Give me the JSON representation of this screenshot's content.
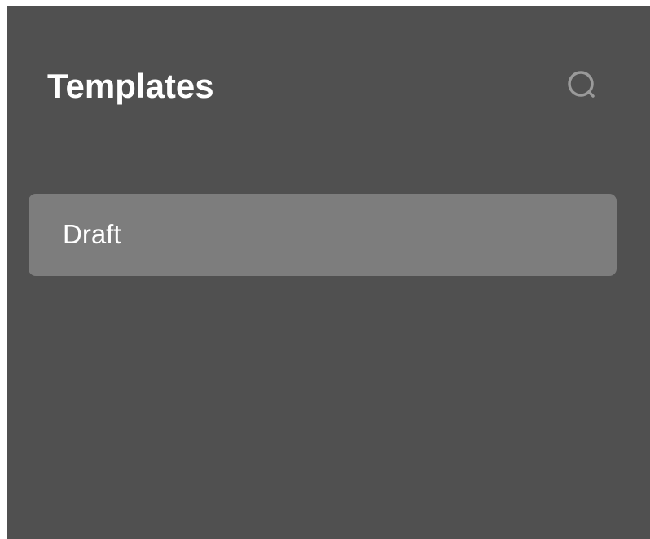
{
  "header": {
    "title": "Templates",
    "search_icon": "search-icon"
  },
  "templates": {
    "items": [
      {
        "label": "Draft",
        "selected": true
      }
    ]
  },
  "colors": {
    "panel_background": "#505050",
    "item_background": "#7d7d7d",
    "divider": "#6a6a6a",
    "text": "#ffffff",
    "icon": "#9a9a9a"
  }
}
